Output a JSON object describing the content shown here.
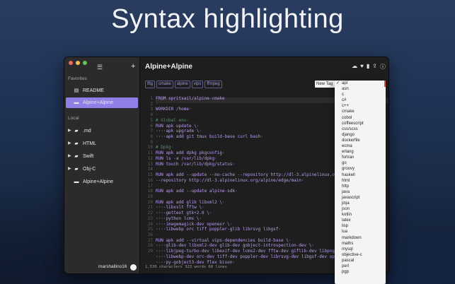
{
  "headline": "Syntax highlighting",
  "window": {
    "traffic_colors": [
      "#ec6a5e",
      "#f4bf4f",
      "#61c554"
    ],
    "sidebar": {
      "favorites_label": "Favorites",
      "local_label": "Local",
      "favorites": [
        {
          "label": "README",
          "icon": "book-icon",
          "active": false
        },
        {
          "label": "Alpine+Alpine",
          "icon": "file-icon",
          "active": true
        }
      ],
      "local": [
        {
          "label": ".md",
          "icon": "folder-icon"
        },
        {
          "label": "HTML",
          "icon": "folder-icon"
        },
        {
          "label": "Swift",
          "icon": "folder-icon"
        },
        {
          "label": "Obj-C",
          "icon": "folder-icon"
        },
        {
          "label": "Alpine+Alpine",
          "icon": "file-icon"
        }
      ],
      "username": "marshallino16"
    },
    "doc_title": "Alpine+Alpine",
    "tags": [
      "tfig",
      "cmake",
      "alpine",
      "vips",
      "ffmpeg"
    ],
    "new_tag_placeholder": "New Tag",
    "line_numbers": [
      "1",
      "2",
      "3",
      "4",
      "5",
      "6",
      "7",
      "8",
      "9",
      "10",
      "11",
      "12",
      "13",
      "14",
      "15",
      "16",
      "17",
      "18",
      "19",
      "20",
      "21",
      "22",
      "23",
      "24",
      "25",
      "26",
      "27",
      "28",
      "29"
    ],
    "code_lines": [
      {
        "t": "FROM spritsail/alpine-cmake",
        "c": ""
      },
      {
        "t": "·",
        "c": "dim"
      },
      {
        "t": "WORKDIR /home·",
        "c": ""
      },
      {
        "t": "·",
        "c": "dim"
      },
      {
        "t": "# Global env·",
        "c": "cm"
      },
      {
        "t": "RUN apk update \\·",
        "c": ""
      },
      {
        "t": "····apk upgrade \\·",
        "c": ""
      },
      {
        "t": "····apk add git tmux build-base curl bash·",
        "c": ""
      },
      {
        "t": "·",
        "c": "dim"
      },
      {
        "t": "# Dpkg·",
        "c": "cm"
      },
      {
        "t": "RUN apk add dpkg pkgconfig·",
        "c": ""
      },
      {
        "t": "RUN ls -a /var/lib/dpkg·",
        "c": ""
      },
      {
        "t": "RUN touch /var/lib/dpkg/status·",
        "c": ""
      },
      {
        "t": "·",
        "c": "dim"
      },
      {
        "t": "RUN apk add --update --no-cache --repository http://dl-3.alpinelinux.org/alpine/edge/main",
        "c": ""
      },
      {
        "t": "--repository http://dl-3.alpinelinux.org/alpine/edge/main·",
        "c": ""
      },
      {
        "t": "·",
        "c": "dim"
      },
      {
        "t": "RUN apk add --update alpine-sdk·",
        "c": ""
      },
      {
        "t": "·",
        "c": "dim"
      },
      {
        "t": "RUN apk add glib libxml2 \\·",
        "c": ""
      },
      {
        "t": "····libxslt fftw \\·",
        "c": ""
      },
      {
        "t": "····gettext gtk+2.0 \\·",
        "c": ""
      },
      {
        "t": "····python lcms \\·",
        "c": ""
      },
      {
        "t": "····imagemagick-dev openexr \\·",
        "c": ""
      },
      {
        "t": "····libwebp orc tiff poppler-glib librsvg libgsf·",
        "c": ""
      },
      {
        "t": "·",
        "c": "dim"
      },
      {
        "t": "RUN apk add --virtual vips-dependencies build-base \\·",
        "c": ""
      },
      {
        "t": "····glib-dev libxml2-dev glib-dev gobject-introspection-dev \\·",
        "c": ""
      },
      {
        "t": "····libjpeg-turbo-dev libexif-dev lcms2-dev fftw-dev giflib-dev libpng-dev",
        "c": ""
      },
      {
        "t": "····libwebp-dev orc-dev tiff-dev poppler-dev librsvg-dev libgsf-dev openexr",
        "c": ""
      },
      {
        "t": "····py-gobject3-dev flex bison·",
        "c": ""
      },
      {
        "t": "·",
        "c": "dim"
      }
    ],
    "status_text": "1,530 characters  323 words  68 lines"
  },
  "dropdown": {
    "selected": "apl",
    "options": [
      "apl",
      "asn",
      "c",
      "c#",
      "c++",
      "cmake",
      "cobol",
      "coffeescript",
      "css/scss",
      "django",
      "dockerfile",
      "ecma",
      "erlang",
      "fortran",
      "go",
      "groovy",
      "haskell",
      "html",
      "http",
      "java",
      "javascript",
      "jinja",
      "json",
      "kotlin",
      "latex",
      "lisp",
      "lua",
      "markdown",
      "maths",
      "mysql",
      "objective-c",
      "pascal",
      "perl",
      "pgp"
    ]
  }
}
